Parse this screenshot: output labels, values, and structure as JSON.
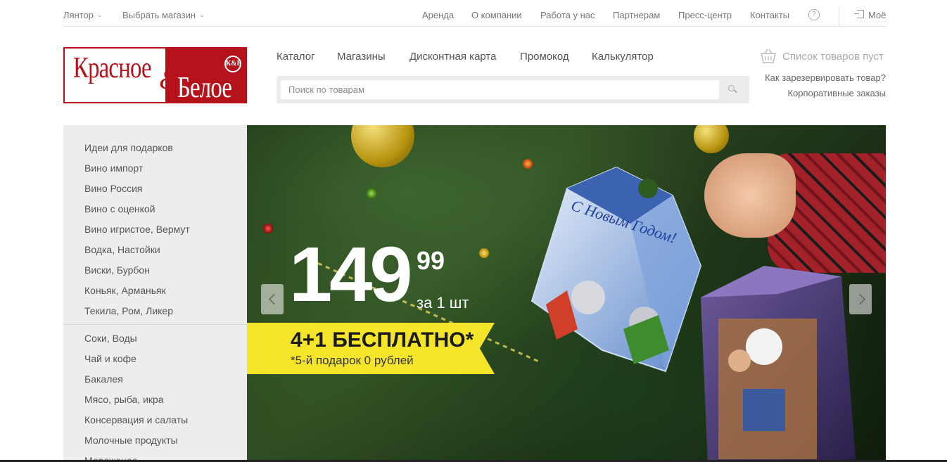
{
  "topbar": {
    "city": "Лянтор",
    "store": "Выбрать магазин",
    "links": [
      "Аренда",
      "О компании",
      "Работа у нас",
      "Партнерам",
      "Пресс-центр",
      "Контакты"
    ],
    "help": "?",
    "account": "Моё"
  },
  "logo": {
    "word1": "Красное",
    "amp": "&",
    "word2": "Белое",
    "badge": "К&Б"
  },
  "nav": [
    "Каталог",
    "Магазины",
    "Дисконтная карта",
    "Промокод",
    "Калькулятор"
  ],
  "search": {
    "placeholder": "Поиск по товарам",
    "icon": "search-icon"
  },
  "cart": {
    "icon": "basket-icon",
    "label": "Список товаров пуст",
    "reserve_link": "Как зарезервировать товар?",
    "corporate_link": "Корпоративные заказы"
  },
  "sidebar": {
    "group1": [
      "Идеи для подарков",
      "Вино импорт",
      "Вино Россия",
      "Вино с оценкой",
      "Вино игристое, Вермут",
      "Водка, Настойки",
      "Виски, Бурбон",
      "Коньяк, Арманьяк",
      "Текила, Ром, Ликер"
    ],
    "group2": [
      "Соки, Воды",
      "Чай и кофе",
      "Бакалея",
      "Мясо, рыба, икра",
      "Консервация и салаты",
      "Молочные продукты",
      "Мороженое"
    ]
  },
  "banner": {
    "price": "149",
    "cents": "99",
    "unit": "за 1 шт",
    "promo": "4+1 БЕСПЛАТНО*",
    "promo_note": "*5-й подарок 0 рублей",
    "box_text": "С Новым Годом!",
    "accent": "#f5e52a"
  },
  "colors": {
    "brand": "#b5121b",
    "sidebar_bg": "#ededed"
  }
}
